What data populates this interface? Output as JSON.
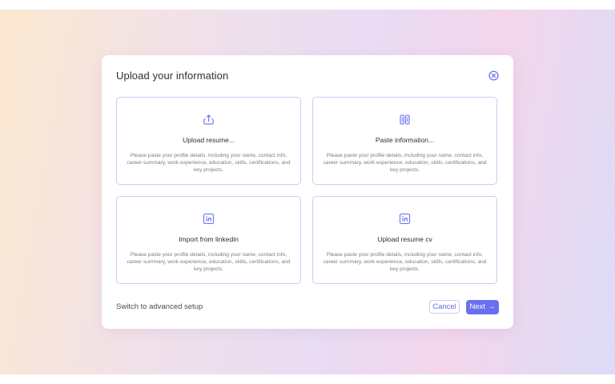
{
  "modal": {
    "title": "Upload your information"
  },
  "options": [
    {
      "icon": "upload-icon",
      "title": "Upload resume...",
      "description": "Please paste your profile details, including your name, contact info, career summary, work experience, education, skills, certifications, and key projects."
    },
    {
      "icon": "columns-icon",
      "title": "Paste information...",
      "description": "Please paste your profile details, including your name, contact info, career summary, work experience, education, skills, certifications, and key projects."
    },
    {
      "icon": "linkedin-icon",
      "title": "Import from linkedin",
      "description": "Please paste your profile details, including your name, contact info, career summary, work experience, education, skills, certifications, and key projects."
    },
    {
      "icon": "linkedin-icon",
      "title": "Upload resume cv",
      "description": "Please paste your profile details, including your name, contact info, career summary, work experience, education, skills, certifications, and key projects."
    }
  ],
  "footer": {
    "advanced_link": "Switch to advanced setup",
    "cancel_label": "Cancel",
    "next_label": "Next",
    "next_arrow": "→"
  },
  "colors": {
    "accent": "#6a6ef0",
    "card_border": "#c9cdf2",
    "text_primary": "#2d2f38",
    "text_secondary": "#7a7d88"
  }
}
